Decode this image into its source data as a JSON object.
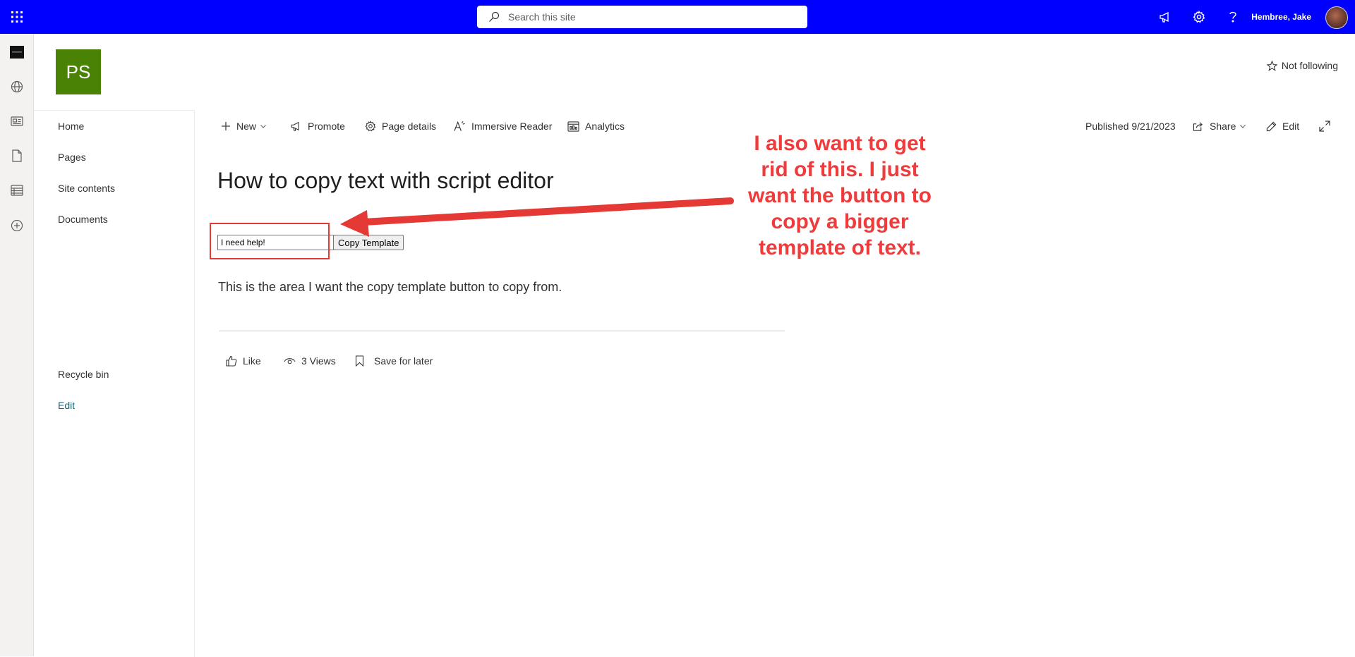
{
  "suite_bar": {
    "search_placeholder": "Search this site",
    "user_name": "Hembree, Jake",
    "icons": [
      "app-launcher-icon",
      "megaphone-icon",
      "gear-icon",
      "help-icon"
    ],
    "accent": "#0000ff"
  },
  "app_bar": {
    "icons": [
      "org-logo-icon",
      "globe-icon",
      "news-icon",
      "document-icon",
      "list-icon",
      "add-icon"
    ]
  },
  "site": {
    "logo_initials": "PS",
    "logo_color": "#498205",
    "follow_label": "Not following"
  },
  "left_nav": {
    "items": [
      {
        "label": "Home"
      },
      {
        "label": "Pages"
      },
      {
        "label": "Site contents"
      },
      {
        "label": "Documents"
      }
    ],
    "recycle_bin": "Recycle bin",
    "edit": "Edit"
  },
  "command_bar": {
    "new": "New",
    "promote": "Promote",
    "page_details": "Page details",
    "immersive_reader": "Immersive Reader",
    "analytics": "Analytics",
    "published": "Published 9/21/2023",
    "share": "Share",
    "edit": "Edit"
  },
  "page": {
    "title": "How to copy text with script editor",
    "input_value": "I need help!",
    "copy_button": "Copy Template",
    "body_text": "This is the area I want the copy template button to copy from."
  },
  "social": {
    "like": "Like",
    "views": "3 Views",
    "save": "Save for later"
  },
  "annotation": {
    "lines": [
      "I also want to get",
      "rid of this. I just",
      "want the button to",
      "copy a bigger",
      "template of text."
    ],
    "color": "#ef3b3b"
  }
}
